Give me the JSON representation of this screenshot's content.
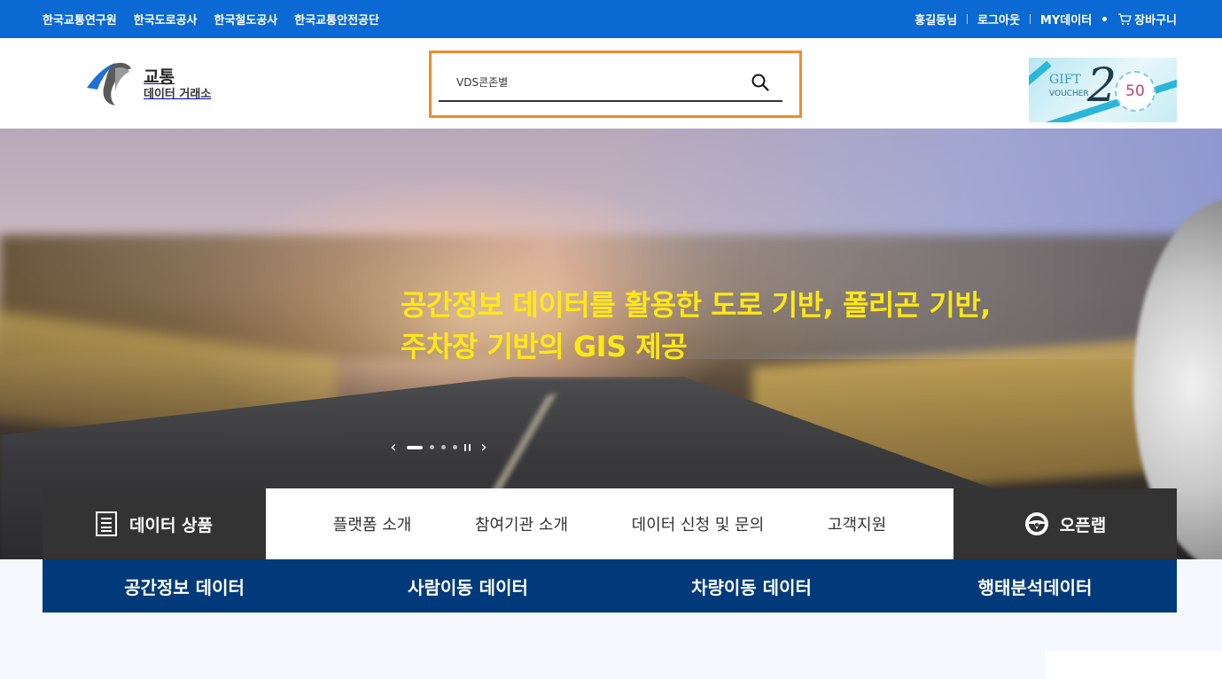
{
  "topbar": {
    "links": [
      "한국교통연구원",
      "한국도로공사",
      "한국철도공사",
      "한국교통안전공단"
    ],
    "user_name": "홍길동님",
    "logout": "로그아웃",
    "my_data": "MY데이터",
    "cart": "장바구니"
  },
  "logo": {
    "line1": "교통",
    "line2": "데이터 거래소"
  },
  "search": {
    "value": "VDS콘존별",
    "icon": "search-icon"
  },
  "voucher": {
    "gift": "GIFT",
    "voucher": "VOUCHER",
    "two": "2",
    "badge": "50"
  },
  "hero": {
    "headline_line1": "공간정보 데이터를 활용한 도로 기반, 폴리곤 기반,",
    "headline_line2": "주차장 기반의 GIS 제공",
    "slide_count": 4,
    "active_slide": 1
  },
  "menubar": {
    "data_products": "데이터 상품",
    "items": [
      "플랫폼 소개",
      "참여기관 소개",
      "데이터 신청 및 문의",
      "고객지원"
    ],
    "open_lab": "오픈랩"
  },
  "categories": [
    "공간정보 데이터",
    "사람이동 데이터",
    "차량이동 데이터",
    "행태분석데이터"
  ],
  "colors": {
    "topbar": "#0a69d3",
    "search_border": "#f18a2b",
    "headline": "#ffe815",
    "menu_dark": "#333333",
    "category_bar": "#003a7a"
  }
}
